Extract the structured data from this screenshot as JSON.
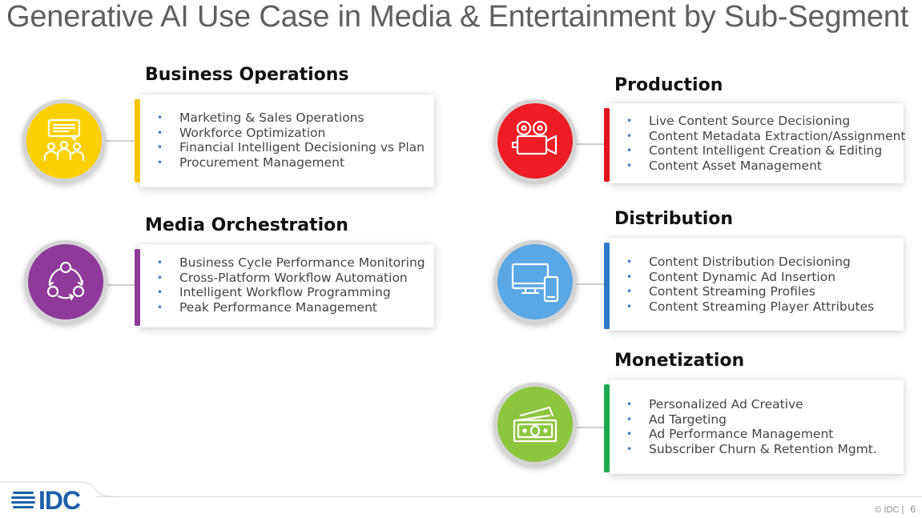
{
  "title": "Generative AI Use Case in Media & Entertainment by Sub-Segment",
  "colors": {
    "business_operations": "#fccf00",
    "media_orchestration": "#8e3a99",
    "production": "#ee1c24",
    "distribution": "#5aa7e6",
    "monetization": "#8cc63f",
    "accent_business_operations": "#f5c400",
    "accent_media_orchestration": "#8e3a99",
    "accent_production": "#e0121b",
    "accent_distribution": "#2e77c8",
    "accent_monetization": "#1daa4f",
    "bullet": "#3a78c0",
    "idc_blue": "#1d5fa7"
  },
  "segments": {
    "business_operations": {
      "heading": "Business Operations",
      "icon": "presentation-audience-icon",
      "items": [
        "Marketing & Sales Operations",
        "Workforce Optimization",
        "Financial Intelligent Decisioning vs Plan",
        "Procurement Management"
      ]
    },
    "media_orchestration": {
      "heading": "Media Orchestration",
      "icon": "workflow-cycle-icon",
      "items": [
        "Business Cycle Performance Monitoring",
        "Cross-Platform Workflow Automation",
        "Intelligent Workflow Programming",
        "Peak Performance Management"
      ]
    },
    "production": {
      "heading": "Production",
      "icon": "film-camera-icon",
      "items": [
        "Live Content Source Decisioning",
        "Content Metadata Extraction/Assignment",
        "Content Intelligent Creation & Editing",
        "Content Asset Management"
      ]
    },
    "distribution": {
      "heading": "Distribution",
      "icon": "monitor-tablet-icon",
      "items": [
        "Content Distribution Decisioning",
        "Content Dynamic Ad Insertion",
        "Content Streaming Profiles",
        "Content Streaming Player Attributes"
      ]
    },
    "monetization": {
      "heading": "Monetization",
      "icon": "money-bills-icon",
      "items": [
        "Personalized Ad Creative",
        "Ad Targeting",
        "Ad Performance Management",
        "Subscriber Churn & Retention Mgmt."
      ]
    }
  },
  "bullet_char": "•",
  "footer": {
    "logo": "IDC",
    "copyright": "© IDC |",
    "page_number": "6"
  }
}
